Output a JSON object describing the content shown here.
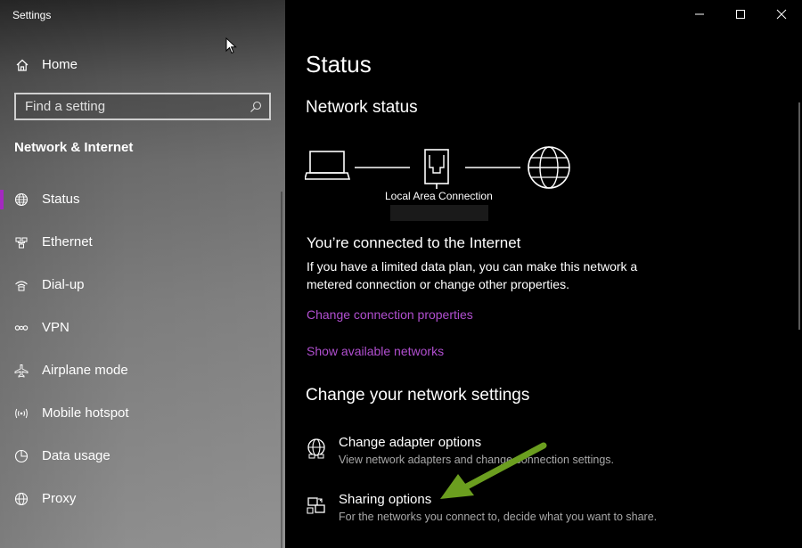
{
  "window": {
    "title": "Settings"
  },
  "sidebar": {
    "home_label": "Home",
    "search_placeholder": "Find a setting",
    "section_title": "Network & Internet",
    "items": [
      {
        "label": "Status",
        "icon": "globe-icon",
        "active": true
      },
      {
        "label": "Ethernet",
        "icon": "ethernet-icon"
      },
      {
        "label": "Dial-up",
        "icon": "dial-up-icon"
      },
      {
        "label": "VPN",
        "icon": "vpn-icon"
      },
      {
        "label": "Airplane mode",
        "icon": "airplane-icon"
      },
      {
        "label": "Mobile hotspot",
        "icon": "hotspot-icon"
      },
      {
        "label": "Data usage",
        "icon": "data-usage-icon"
      },
      {
        "label": "Proxy",
        "icon": "proxy-globe-icon"
      }
    ]
  },
  "main": {
    "page_title": "Status",
    "network_status_heading": "Network status",
    "connection_name": "Local Area Connection",
    "connected_heading": "You’re connected to the Internet",
    "connected_text": "If you have a limited data plan, you can make this network a metered connection or change other properties.",
    "link_change_properties": "Change connection properties",
    "link_show_networks": "Show available networks",
    "change_settings_heading": "Change your network settings",
    "options": [
      {
        "title": "Change adapter options",
        "desc": "View network adapters and change connection settings.",
        "icon": "adapter-globe-icon"
      },
      {
        "title": "Sharing options",
        "desc": "For the networks you connect to, decide what you want to share.",
        "icon": "sharing-icon"
      }
    ]
  },
  "colors": {
    "accent": "#a429c0",
    "link": "#b14fd0",
    "annotation_arrow": "#6b9e1f"
  }
}
